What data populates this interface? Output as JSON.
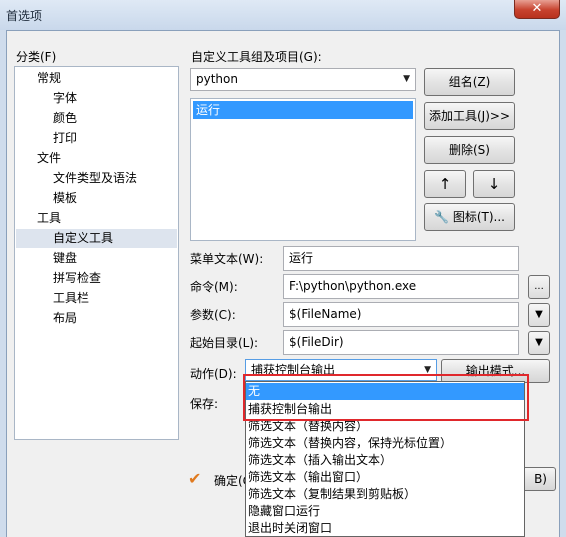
{
  "window": {
    "title": "首选项",
    "close_icon": "close-icon"
  },
  "categories": {
    "label": "分类(F)",
    "items": [
      "常规",
      "字体",
      "颜色",
      "打印",
      "文件",
      "文件类型及语法",
      "模板",
      "工具",
      "自定义工具",
      "键盘",
      "拼写检查",
      "工具栏",
      "布局"
    ],
    "selected": "自定义工具"
  },
  "tools": {
    "group_label": "自定义工具组及项目(G):",
    "group_value": "python",
    "list_items": [
      "运行"
    ],
    "selected_item": "运行"
  },
  "buttons": {
    "group": "组名(Z)",
    "add_tool": "添加工具(J)>>",
    "delete": "删除(S)",
    "up": "↑",
    "down": "↓",
    "icon": "图标(T)...",
    "output_mode": "输出模式...",
    "browse": "...",
    "ok": "确定(C",
    "cut_off_right": "B)"
  },
  "form": {
    "menu_text_label": "菜单文本(W):",
    "menu_text_value": "运行",
    "command_label": "命令(M):",
    "command_value": "F:\\python\\python.exe",
    "params_label": "参数(C):",
    "params_value": "$(FileName)",
    "start_dir_label": "起始目录(L):",
    "start_dir_value": "$(FileDir)",
    "action_label": "动作(D):",
    "action_value": "捕获控制台输出",
    "save_label": "保存:"
  },
  "dropdown": {
    "options": [
      "无",
      "捕获控制台输出",
      "筛选文本（替换内容）",
      "筛选文本（替换内容，保持光标位置）",
      "筛选文本（插入输出文本）",
      "筛选文本（输出窗口）",
      "筛选文本（复制结果到剪贴板）",
      "隐藏窗口运行",
      "退出时关闭窗口"
    ],
    "highlighted": "无"
  },
  "colors": {
    "selection": "#3399ff",
    "tree_selection": "#dde4ee",
    "annotation_box": "#e0282c"
  }
}
